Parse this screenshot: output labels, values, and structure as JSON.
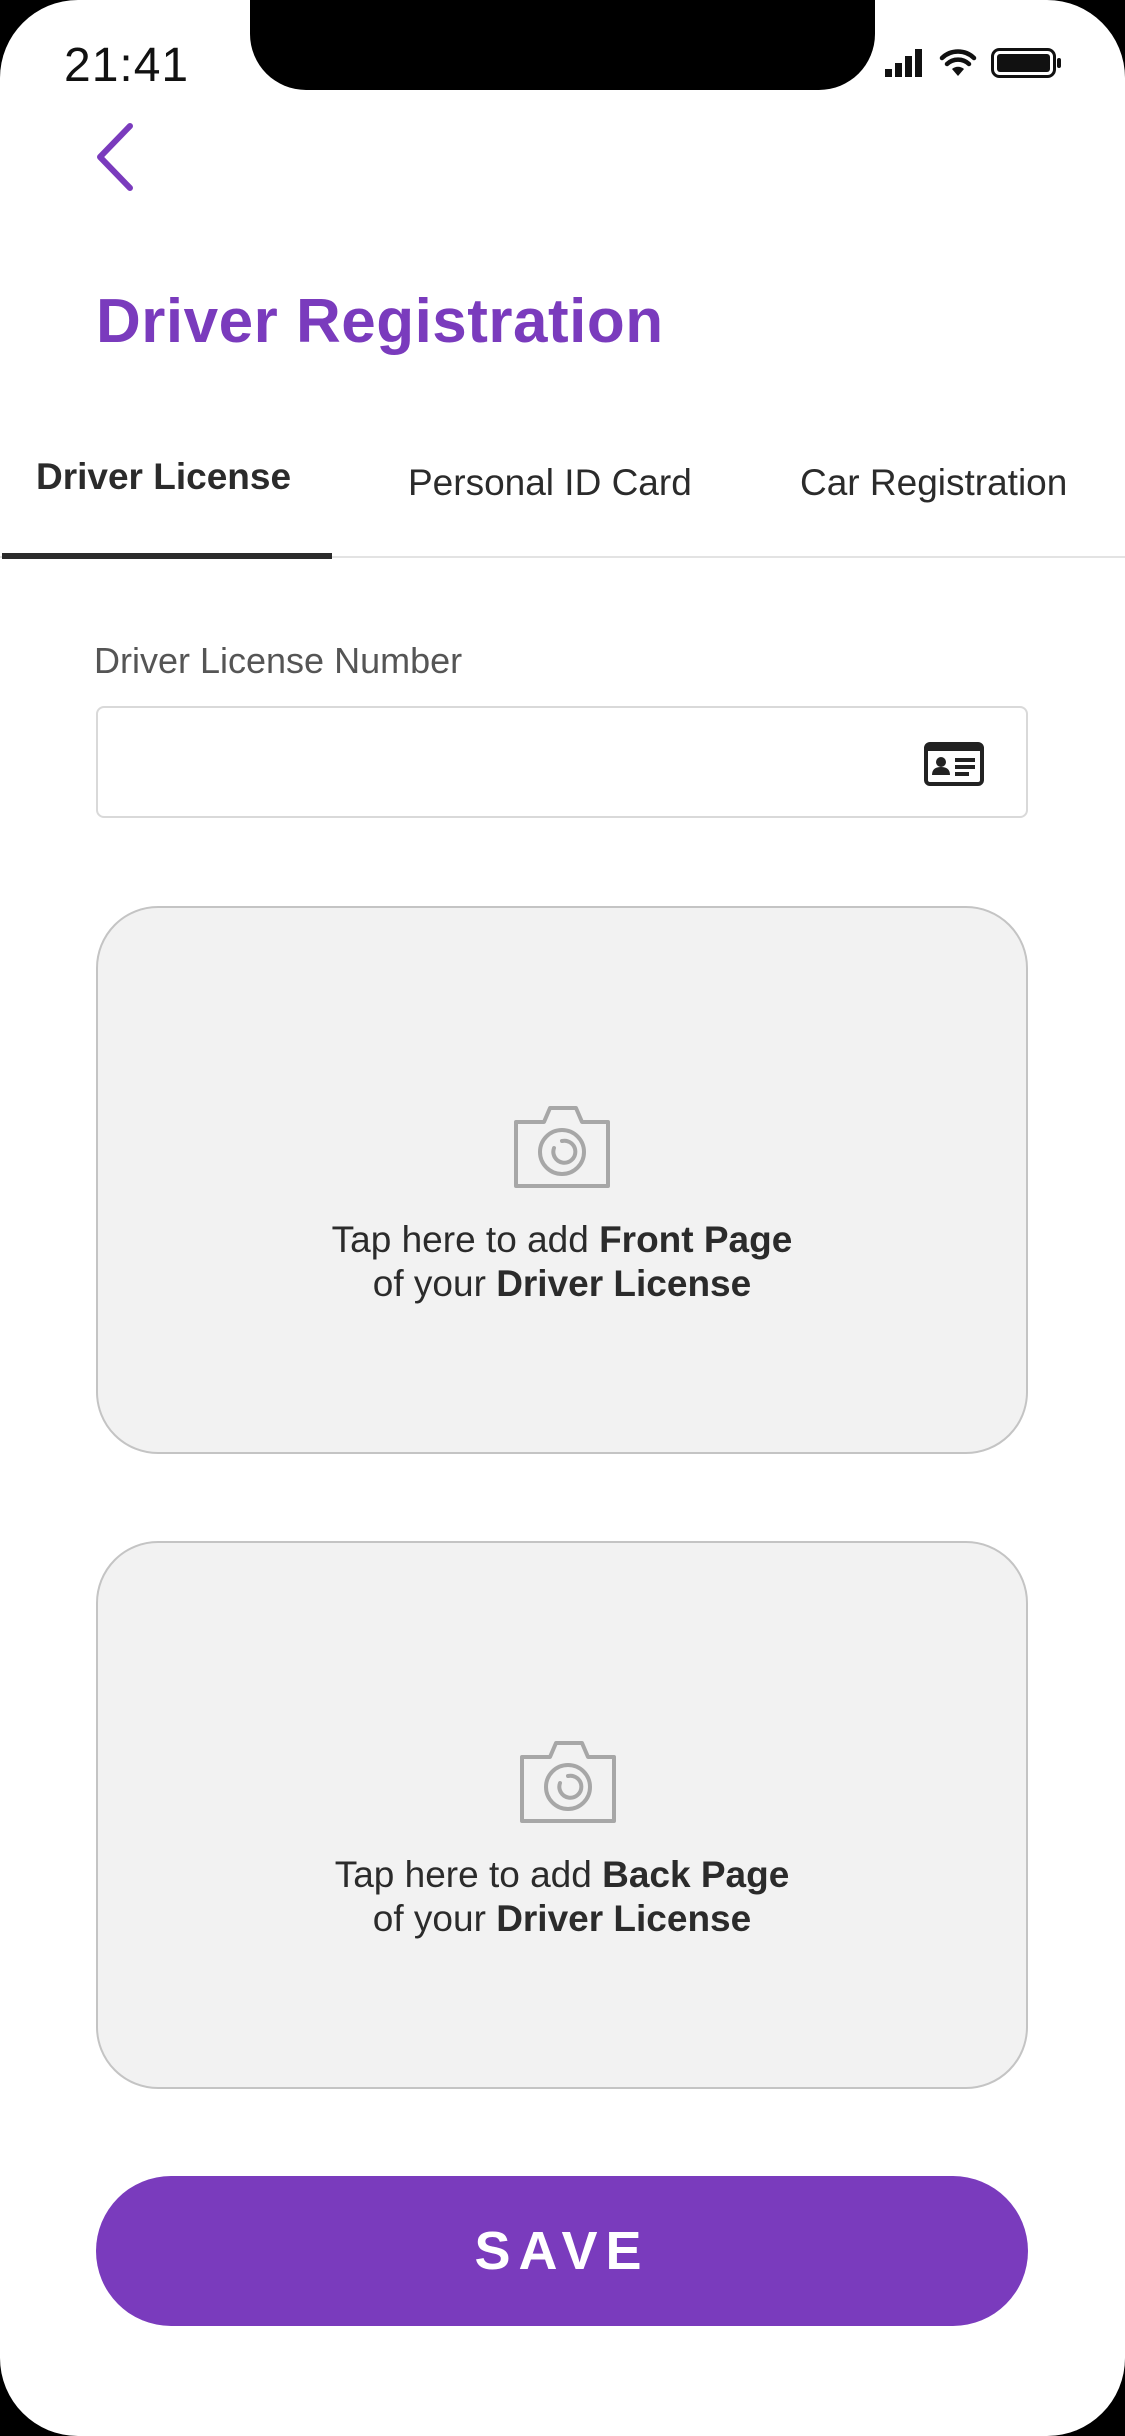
{
  "status_bar": {
    "time": "21:41",
    "icons": [
      "cellular-signal-icon",
      "wifi-icon",
      "battery-icon"
    ]
  },
  "header": {
    "back_icon": "chevron-left-icon",
    "title": "Driver Registration"
  },
  "tabs": [
    {
      "label": "Driver License",
      "active": true
    },
    {
      "label": "Personal ID Card",
      "active": false
    },
    {
      "label": "Car Registration",
      "active": false
    }
  ],
  "form": {
    "license_number": {
      "label": "Driver License Number",
      "value": "",
      "placeholder": "",
      "icon": "id-card-icon"
    },
    "front_upload": {
      "icon": "camera-icon",
      "line1_prefix": "Tap here to add ",
      "line1_bold": "Front Page",
      "line2_prefix": "of your ",
      "line2_bold": "Driver License"
    },
    "back_upload": {
      "icon": "camera-icon",
      "line1_prefix": "Tap here to add ",
      "line1_bold": "Back Page",
      "line2_prefix": "of your ",
      "line2_bold": "Driver License"
    }
  },
  "actions": {
    "save_label": "SAVE"
  },
  "colors": {
    "accent": "#7a3bbd",
    "text": "#2b2b2b",
    "card_background": "#f2f2f2",
    "card_border": "#c4c4c4"
  }
}
